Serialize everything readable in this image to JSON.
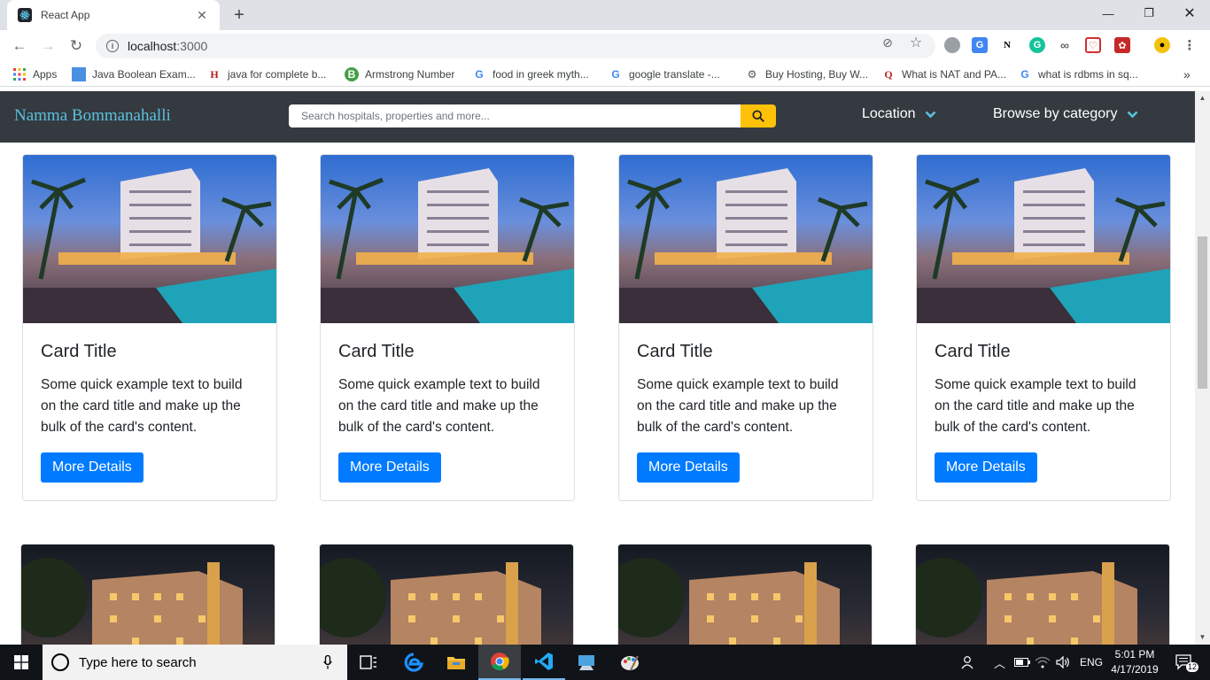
{
  "browser": {
    "tab_title": "React App",
    "url_host": "localhost",
    "url_port": ":3000",
    "bookmarks": [
      {
        "label": "Apps",
        "icon": "apps-grid-icon"
      },
      {
        "label": "Java Boolean Exam...",
        "icon": "page-icon"
      },
      {
        "label": "java for complete b...",
        "icon": "hl-icon"
      },
      {
        "label": "Armstrong Number",
        "icon": "b-icon"
      },
      {
        "label": "food in greek myth...",
        "icon": "google-icon"
      },
      {
        "label": "google translate -...",
        "icon": "google-icon"
      },
      {
        "label": "Buy Hosting, Buy W...",
        "icon": "hosting-icon"
      },
      {
        "label": "What is NAT and PA...",
        "icon": "quora-icon"
      },
      {
        "label": "what is rdbms in sq...",
        "icon": "google-icon"
      }
    ]
  },
  "navbar": {
    "brand": "Namma Bommanahalli",
    "search_placeholder": "Search hospitals, properties and more...",
    "location_label": "Location",
    "category_label": "Browse by category"
  },
  "cards": [
    {
      "title": "Card Title",
      "text": "Some quick example text to build on the card title and make up the bulk of the card's content.",
      "button": "More Details",
      "image": "hotel-pool"
    },
    {
      "title": "Card Title",
      "text": "Some quick example text to build on the card title and make up the bulk of the card's content.",
      "button": "More Details",
      "image": "hotel-pool"
    },
    {
      "title": "Card Title",
      "text": "Some quick example text to build on the card title and make up the bulk of the card's content.",
      "button": "More Details",
      "image": "hotel-pool"
    },
    {
      "title": "Card Title",
      "text": "Some quick example text to build on the card title and make up the bulk of the card's content.",
      "button": "More Details",
      "image": "hotel-pool"
    }
  ],
  "row2_images": [
    "apartment-building",
    "apartment-building",
    "apartment-building",
    "apartment-building"
  ],
  "taskbar": {
    "search_text": "Type here to search",
    "language": "ENG",
    "time": "5:01 PM",
    "date": "4/17/2019",
    "notification_count": "12"
  },
  "colors": {
    "navbar_bg": "#343a40",
    "brand": "#5bc0de",
    "search_button": "#ffc107",
    "primary_button": "#007bff"
  }
}
